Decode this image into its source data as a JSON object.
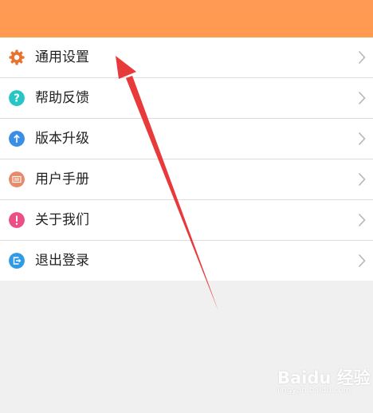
{
  "colors": {
    "header": "#ff9a52",
    "background": "#f0f0f0",
    "divider": "#dcdcdc",
    "arrow": "#e8393b"
  },
  "menu": {
    "items": [
      {
        "label": "通用设置",
        "icon": "gear-icon",
        "icon_color": "#e8732e"
      },
      {
        "label": "帮助反馈",
        "icon": "question-icon",
        "icon_color": "#27c6c4"
      },
      {
        "label": "版本升级",
        "icon": "upgrade-arrow-icon",
        "icon_color": "#3a8ee6"
      },
      {
        "label": "用户手册",
        "icon": "manual-icon",
        "icon_color": "#e8896a"
      },
      {
        "label": "关于我们",
        "icon": "info-icon",
        "icon_color": "#ec4f86"
      },
      {
        "label": "退出登录",
        "icon": "logout-icon",
        "icon_color": "#2f9be6"
      }
    ]
  },
  "watermark": {
    "brand": "Baidu 经验",
    "url": "jingyan.baidu.com"
  }
}
